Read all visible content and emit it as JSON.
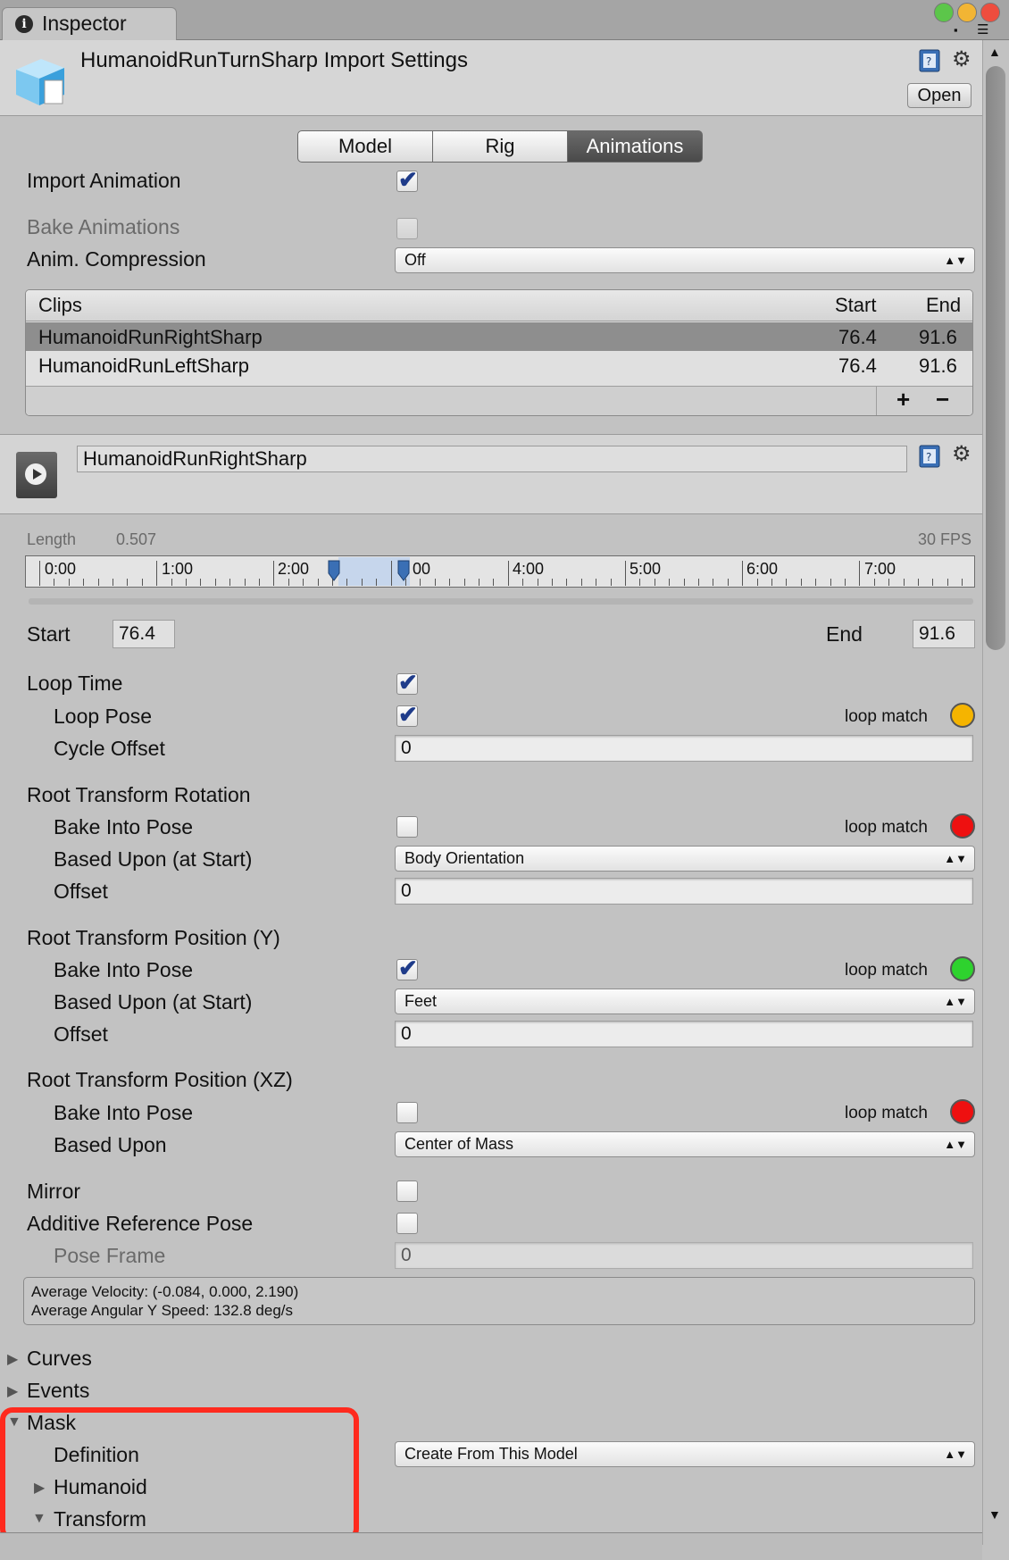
{
  "window": {
    "tab_label": "Inspector"
  },
  "header": {
    "title": "HumanoidRunTurnSharp Import Settings",
    "open_label": "Open"
  },
  "tabs": [
    {
      "label": "Model"
    },
    {
      "label": "Rig"
    },
    {
      "label": "Animations"
    }
  ],
  "import": {
    "import_animation_label": "Import Animation",
    "import_animation": true,
    "bake_animations_label": "Bake Animations",
    "bake_animations": false,
    "compression_label": "Anim. Compression",
    "compression_value": "Off"
  },
  "clips": {
    "header": {
      "name": "Clips",
      "start": "Start",
      "end": "End"
    },
    "rows": [
      {
        "name": "HumanoidRunRightSharp",
        "start": "76.4",
        "end": "91.6"
      },
      {
        "name": "HumanoidRunLeftSharp",
        "start": "76.4",
        "end": "91.6"
      }
    ],
    "add_label": "+",
    "remove_label": "−"
  },
  "clip": {
    "name": "HumanoidRunRightSharp",
    "length_label": "Length",
    "length_value": "0.507",
    "fps": "30 FPS",
    "timeline_labels": [
      "0:00",
      "1:00",
      "2:00",
      "00",
      "4:00",
      "5:00",
      "6:00",
      "7:00"
    ],
    "start_label": "Start",
    "start_value": "76.4",
    "end_label": "End",
    "end_value": "91.6"
  },
  "loop": {
    "loop_time_label": "Loop Time",
    "loop_time": true,
    "loop_pose_label": "Loop Pose",
    "loop_pose": true,
    "loop_match_label": "loop match",
    "loop_match_color": "#f5b400",
    "cycle_offset_label": "Cycle Offset",
    "cycle_offset": "0"
  },
  "root_rotation": {
    "title": "Root Transform Rotation",
    "bake_label": "Bake Into Pose",
    "bake": false,
    "loop_match_label": "loop match",
    "loop_match_color": "#ee1010",
    "based_upon_label": "Based Upon (at Start)",
    "based_upon": "Body Orientation",
    "offset_label": "Offset",
    "offset": "0"
  },
  "root_pos_y": {
    "title": "Root Transform Position (Y)",
    "bake_label": "Bake Into Pose",
    "bake": true,
    "loop_match_label": "loop match",
    "loop_match_color": "#2ed22e",
    "based_upon_label": "Based Upon (at Start)",
    "based_upon": "Feet",
    "offset_label": "Offset",
    "offset": "0"
  },
  "root_pos_xz": {
    "title": "Root Transform Position (XZ)",
    "bake_label": "Bake Into Pose",
    "bake": false,
    "loop_match_label": "loop match",
    "loop_match_color": "#ee1010",
    "based_upon_label": "Based Upon",
    "based_upon": "Center of Mass"
  },
  "misc": {
    "mirror_label": "Mirror",
    "mirror": false,
    "additive_label": "Additive Reference Pose",
    "additive": false,
    "pose_frame_label": "Pose Frame",
    "pose_frame": "0"
  },
  "info": {
    "velocity": "Average Velocity: (-0.084, 0.000, 2.190)",
    "angular": "Average Angular Y Speed: 132.8 deg/s"
  },
  "foldouts": {
    "curves": "Curves",
    "events": "Events",
    "mask": "Mask",
    "definition_label": "Definition",
    "definition_value": "Create From This Model",
    "humanoid": "Humanoid",
    "transform": "Transform"
  },
  "colors": {
    "highlight": "#ff2a1e",
    "selection": "#8e8e8e"
  }
}
